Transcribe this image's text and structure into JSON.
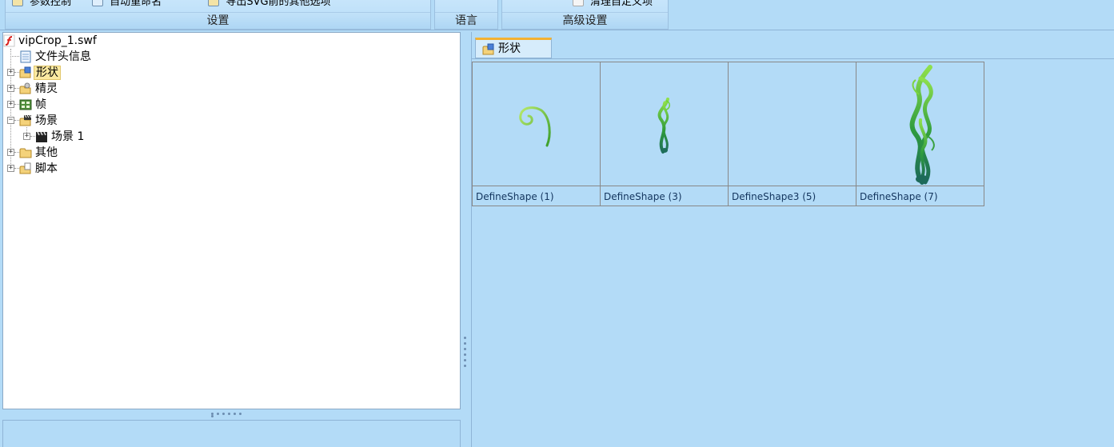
{
  "ribbon": {
    "groups": [
      {
        "title": "设置",
        "items": [
          "参数控制",
          "自动重命名",
          "导出SVG前的其他选项"
        ]
      },
      {
        "title": "语言",
        "items": []
      },
      {
        "title": "高级设置",
        "items": [
          "清理自定义项"
        ]
      }
    ]
  },
  "tree": {
    "root": "vipCrop_1.swf",
    "items": [
      {
        "label": "文件头信息",
        "icon": "document-icon",
        "expandable": false
      },
      {
        "label": "形状",
        "icon": "shape-folder-icon",
        "expandable": true,
        "selected": true
      },
      {
        "label": "精灵",
        "icon": "sprite-folder-icon",
        "expandable": true
      },
      {
        "label": "帧",
        "icon": "frame-folder-icon",
        "expandable": true
      },
      {
        "label": "场景",
        "icon": "scene-folder-icon",
        "expandable": true,
        "expanded": true,
        "children": [
          {
            "label": "场景 1",
            "icon": "clapper-icon",
            "expandable": true
          }
        ]
      },
      {
        "label": "其他",
        "icon": "folder-icon",
        "expandable": true
      },
      {
        "label": "脚本",
        "icon": "script-folder-icon",
        "expandable": true
      }
    ]
  },
  "tab": {
    "label": "形状"
  },
  "shapes": [
    {
      "caption": "DefineShape (1)",
      "thumb": "small-curl"
    },
    {
      "caption": "DefineShape (3)",
      "thumb": "small-vine"
    },
    {
      "caption": "DefineShape3 (5)",
      "thumb": "empty"
    },
    {
      "caption": "DefineShape (7)",
      "thumb": "large-vine"
    }
  ],
  "colors": {
    "background": "#b3dbf7",
    "panel": "#ffffff",
    "selection": "#fbe9a1",
    "vine_light": "#6fd23a",
    "vine_dark": "#1f6f5a"
  }
}
